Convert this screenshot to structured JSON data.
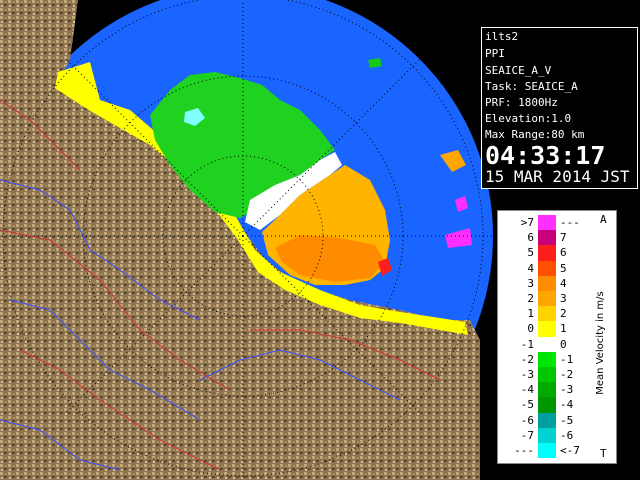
{
  "info_panel": {
    "site": "ilts2",
    "product": "PPI",
    "field": "SEAICE_A_V",
    "task": "Task: SEAICE_A",
    "prf": "PRF: 1800Hz",
    "elevation": "Elevation:1.0",
    "max_range": "Max Range:80 km",
    "time": "04:33:17",
    "date": "15 MAR 2014 JST"
  },
  "legend": {
    "title": "Mean Velocity in m/s",
    "top_marker": "A",
    "bottom_marker": "T",
    "rows": [
      {
        "left": ">7",
        "right": "---",
        "color": "#ff30ff"
      },
      {
        "left": "6",
        "right": "7",
        "color": "#c8007a"
      },
      {
        "left": "5",
        "right": "6",
        "color": "#ff1e1e"
      },
      {
        "left": "4",
        "right": "5",
        "color": "#ff5000"
      },
      {
        "left": "3",
        "right": "4",
        "color": "#ff8c00"
      },
      {
        "left": "2",
        "right": "3",
        "color": "#ffa500"
      },
      {
        "left": "1",
        "right": "2",
        "color": "#ffd200"
      },
      {
        "left": "0",
        "right": "1",
        "color": "#ffff00"
      },
      {
        "left": "-1",
        "right": "0",
        "color": "#ffffff"
      },
      {
        "left": "-2",
        "right": "-1",
        "color": "#00e600"
      },
      {
        "left": "-3",
        "right": "-2",
        "color": "#00c800"
      },
      {
        "left": "-4",
        "right": "-3",
        "color": "#00aa00"
      },
      {
        "left": "-5",
        "right": "-4",
        "color": "#009600"
      },
      {
        "left": "-6",
        "right": "-5",
        "color": "#00a0a0"
      },
      {
        "left": "-7",
        "right": "-6",
        "color": "#00d2d2"
      },
      {
        "left": "---",
        "right": "<-7",
        "color": "#00ffff"
      }
    ]
  },
  "colors": {
    "background": "#000000",
    "sea_echo_range": "#1464ff",
    "coast_clutter": "#ffff00",
    "terrain": "#9a7f5a",
    "rivers": "#3c50ff",
    "borders": "#d23232"
  }
}
